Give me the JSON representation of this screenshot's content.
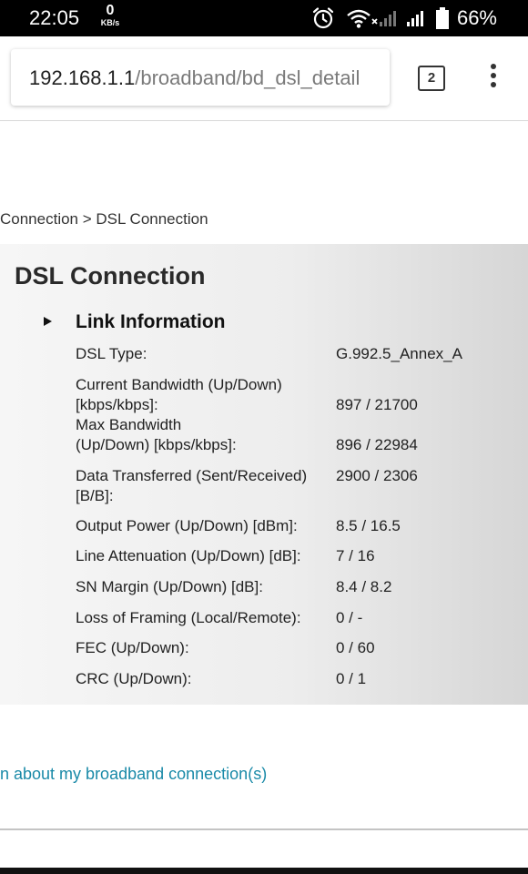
{
  "status_bar": {
    "time": "22:05",
    "rate_value": "0",
    "rate_unit": "KB/s",
    "battery": "66%",
    "icons": [
      "alarm-icon",
      "wifi-icon",
      "signal-x-icon",
      "signal-icon",
      "battery-icon"
    ]
  },
  "browser": {
    "url_host": "192.168.1.1",
    "url_path": "/broadband/bd_dsl_detail",
    "tab_count": "2",
    "menu_icon": "overflow-menu-icon"
  },
  "breadcrumb": "Connection > DSL Connection",
  "panel": {
    "title": "DSL Connection",
    "section_title": "Link Information",
    "rows": [
      {
        "label_lines": [
          "DSL Type:"
        ],
        "value": "G.992.5_Annex_A"
      },
      {
        "label_lines": [
          "Current Bandwidth (Up/Down)",
          "[kbps/kbps]:"
        ],
        "value": "897 / 21700"
      },
      {
        "label_lines": [
          "Max Bandwidth",
          "(Up/Down) [kbps/kbps]:"
        ],
        "value": "896 / 22984"
      },
      {
        "label_lines": [
          "Data Transferred (Sent/Received)",
          "[B/B]:"
        ],
        "value": "2900 / 2306"
      },
      {
        "label_lines": [
          "Output Power (Up/Down) [dBm]:"
        ],
        "value": "8.5 / 16.5"
      },
      {
        "label_lines": [
          "Line Attenuation (Up/Down) [dB]:"
        ],
        "value": "7 / 16"
      },
      {
        "label_lines": [
          "SN Margin (Up/Down) [dB]:"
        ],
        "value": "8.4 / 8.2"
      },
      {
        "label_lines": [
          "Loss of Framing (Local/Remote):"
        ],
        "value": "0 / -"
      },
      {
        "label_lines": [
          "FEC (Up/Down):"
        ],
        "value": "0 / 60"
      },
      {
        "label_lines": [
          "CRC (Up/Down):"
        ],
        "value": "0 / 1"
      }
    ]
  },
  "footer_link": "n about my broadband connection(s)",
  "colors": {
    "link": "#1a8aa8",
    "status_bar_bg": "#000000",
    "panel_bg": "#eeeeee"
  }
}
